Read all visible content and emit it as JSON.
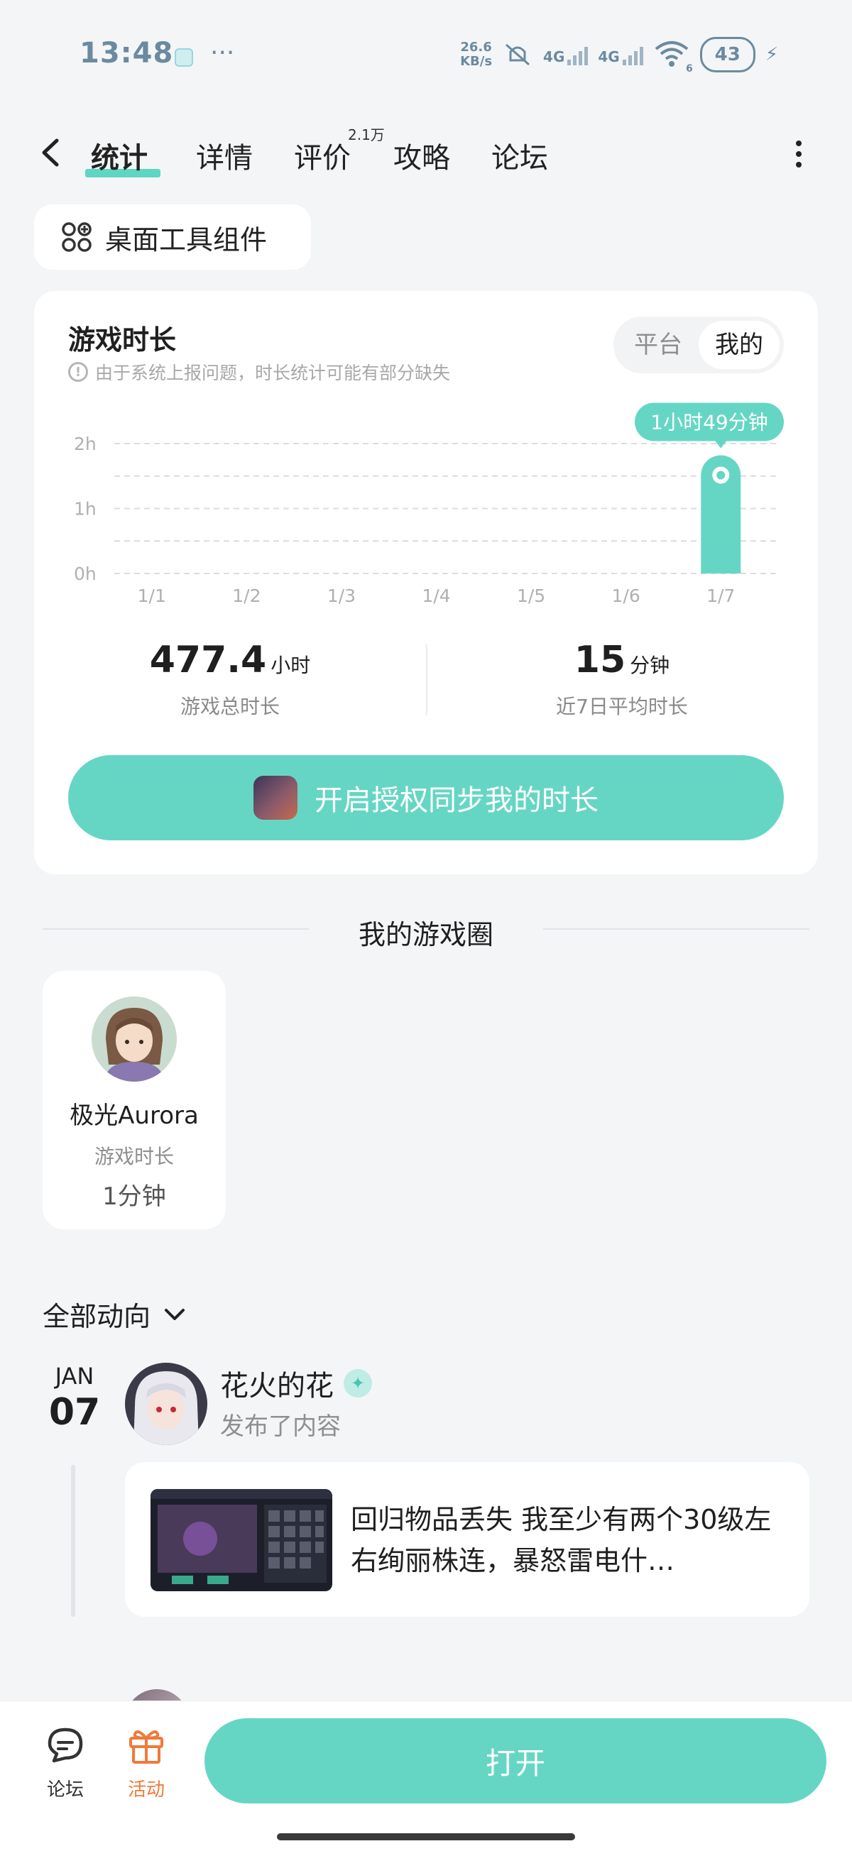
{
  "status_bar": {
    "time": "13:48",
    "net_speed_value": "26.6",
    "net_speed_unit": "KB/s",
    "sim1": "4G",
    "sim2": "4G",
    "wifi_badge": "6",
    "battery": "43"
  },
  "nav": {
    "tabs": [
      {
        "label": "统计",
        "active": true
      },
      {
        "label": "详情",
        "active": false
      },
      {
        "label": "评价",
        "active": false,
        "badge": "2.1万"
      },
      {
        "label": "攻略",
        "active": false
      },
      {
        "label": "论坛",
        "active": false
      }
    ]
  },
  "widget_chip": {
    "label": "桌面工具组件"
  },
  "playtime": {
    "title": "游戏时长",
    "note": "由于系统上报问题，时长统计可能有部分缺失",
    "toggle": {
      "options": [
        "平台",
        "我的"
      ],
      "selected": "我的"
    },
    "tooltip": "1小时49分钟",
    "total_value": "477.4",
    "total_unit": "小时",
    "total_label": "游戏总时长",
    "avg_value": "15",
    "avg_unit": "分钟",
    "avg_label": "近7日平均时长",
    "sync_button": "开启授权同步我的时长"
  },
  "chart_data": {
    "type": "bar",
    "categories": [
      "1/1",
      "1/2",
      "1/3",
      "1/4",
      "1/5",
      "1/6",
      "1/7"
    ],
    "values": [
      0,
      0,
      0,
      0,
      0,
      0,
      1.82
    ],
    "ylabel": "",
    "yticks": [
      "0h",
      "1h",
      "2h"
    ],
    "ylim": [
      0,
      2
    ],
    "grid": true,
    "bar_color": "#66d6c4"
  },
  "game_circle": {
    "title": "我的游戏圈",
    "member": {
      "name": "极光Aurora",
      "label": "游戏时长",
      "value": "1分钟"
    }
  },
  "feed": {
    "filter_label": "全部动向",
    "items": [
      {
        "month": "JAN",
        "day": "07",
        "user": "花火的花",
        "action": "发布了内容",
        "post_text": "回归物品丢失 我至少有两个30级左右绚丽株连，暴怒雷电什…"
      }
    ]
  },
  "bottom_bar": {
    "forum_label": "论坛",
    "events_label": "活动",
    "open_button": "打开"
  },
  "colors": {
    "accent": "#66d6c4",
    "events_orange": "#f07a3a",
    "background": "#f4f5f7"
  }
}
